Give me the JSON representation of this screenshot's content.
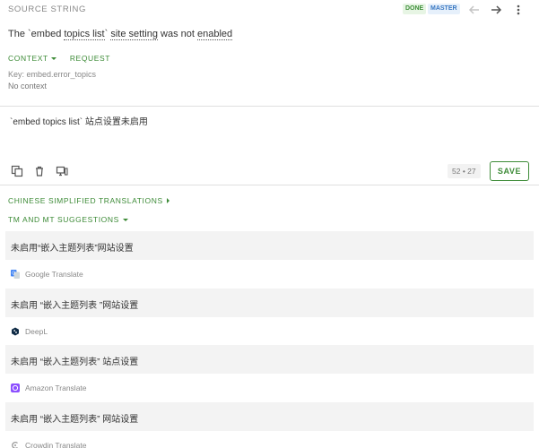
{
  "header": {
    "title": "SOURCE STRING",
    "badge_done": "DONE",
    "badge_master": "MASTER"
  },
  "source": {
    "part1": "The `embed ",
    "part2": "topics list",
    "part3": "` ",
    "part4": "site setting",
    "part5": " was not ",
    "part6": "enabled"
  },
  "context": {
    "tab_context": "CONTEXT",
    "tab_request": "REQUEST",
    "key": "Key: embed.error_topics",
    "value": "No context"
  },
  "translation": {
    "text": "`embed topics list` 站点设置未启用"
  },
  "toolbar": {
    "char_count": "52 • 27",
    "save_label": "SAVE"
  },
  "sections": {
    "translations_title": "CHINESE SIMPLIFIED TRANSLATIONS",
    "suggestions_title": "TM AND MT SUGGESTIONS"
  },
  "suggestions": [
    {
      "text": "未启用“嵌入主题列表”网站设置",
      "provider": "Google Translate",
      "icon": "google-translate-icon",
      "color": "#4285f4"
    },
    {
      "text": "未启用 “嵌入主题列表 ”网站设置",
      "provider": "DeepL",
      "icon": "deepl-icon",
      "color": "#0f2b46"
    },
    {
      "text": "未启用 “嵌入主题列表” 站点设置",
      "provider": "Amazon Translate",
      "icon": "amazon-translate-icon",
      "color": "#8c4fff"
    },
    {
      "text": "未启用 “嵌入主题列表” 网站设置",
      "provider": "Crowdin Translate",
      "icon": "crowdin-translate-icon",
      "color": "#999999"
    }
  ],
  "colors": {
    "accent": "#3d8b37",
    "done_badge": "#3f8f3a",
    "master_badge": "#3a78c2"
  }
}
